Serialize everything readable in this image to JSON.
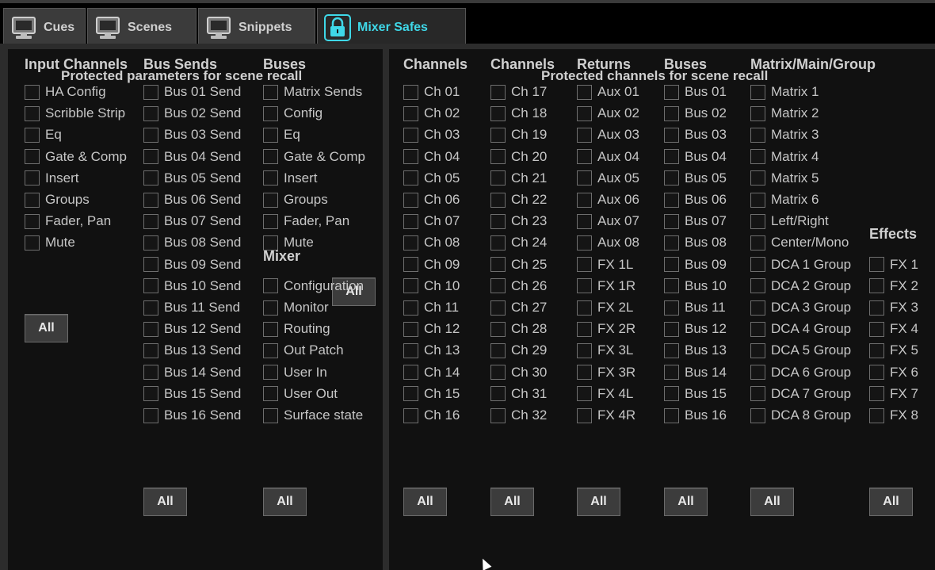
{
  "tabs": [
    {
      "label": "Cues",
      "icon": "monitor-icon",
      "active": false
    },
    {
      "label": "Scenes",
      "icon": "monitor-icon",
      "active": false
    },
    {
      "label": "Snippets",
      "icon": "monitor-icon",
      "active": false
    },
    {
      "label": "Mixer Safes",
      "icon": "lock-icon",
      "active": true
    }
  ],
  "accent_color": "#3fd8e8",
  "left_panel": {
    "title": "Protected parameters for scene recall",
    "columns": [
      {
        "header": "Input Channels",
        "items": [
          "HA Config",
          "Scribble Strip",
          "Eq",
          "Gate & Comp",
          "Insert",
          "Groups",
          "Fader, Pan",
          "Mute"
        ]
      },
      {
        "header": "Bus Sends",
        "items": [
          "Bus 01 Send",
          "Bus 02 Send",
          "Bus 03 Send",
          "Bus 04 Send",
          "Bus 05 Send",
          "Bus 06 Send",
          "Bus 07 Send",
          "Bus 08 Send",
          "Bus 09 Send",
          "Bus 10 Send",
          "Bus 11 Send",
          "Bus 12 Send",
          "Bus 13 Send",
          "Bus 14 Send",
          "Bus 15 Send",
          "Bus 16 Send"
        ]
      },
      {
        "header": "Buses",
        "items": [
          "Matrix Sends",
          "Config",
          "Eq",
          "Gate & Comp",
          "Insert",
          "Groups",
          "Fader, Pan",
          "Mute"
        ]
      },
      {
        "header": "Mixer",
        "items": [
          "Configuration",
          "Monitor",
          "Routing",
          "Out Patch",
          "User In",
          "User Out",
          "Surface state"
        ]
      }
    ],
    "all_label": "All"
  },
  "right_panel": {
    "title": "Protected channels for scene recall",
    "columns": [
      {
        "header": "Channels",
        "items": [
          "Ch 01",
          "Ch 02",
          "Ch 03",
          "Ch 04",
          "Ch 05",
          "Ch 06",
          "Ch 07",
          "Ch 08",
          "Ch 09",
          "Ch 10",
          "Ch 11",
          "Ch 12",
          "Ch 13",
          "Ch 14",
          "Ch 15",
          "Ch 16"
        ]
      },
      {
        "header": "Channels",
        "items": [
          "Ch 17",
          "Ch 18",
          "Ch 19",
          "Ch 20",
          "Ch 21",
          "Ch 22",
          "Ch 23",
          "Ch 24",
          "Ch 25",
          "Ch 26",
          "Ch 27",
          "Ch 28",
          "Ch 29",
          "Ch 30",
          "Ch 31",
          "Ch 32"
        ]
      },
      {
        "header": "Returns",
        "items": [
          "Aux 01",
          "Aux 02",
          "Aux 03",
          "Aux 04",
          "Aux 05",
          "Aux 06",
          "Aux 07",
          "Aux 08",
          "FX 1L",
          "FX 1R",
          "FX 2L",
          "FX 2R",
          "FX 3L",
          "FX 3R",
          "FX 4L",
          "FX 4R"
        ]
      },
      {
        "header": "Buses",
        "items": [
          "Bus 01",
          "Bus 02",
          "Bus 03",
          "Bus 04",
          "Bus 05",
          "Bus 06",
          "Bus 07",
          "Bus 08",
          "Bus 09",
          "Bus 10",
          "Bus 11",
          "Bus 12",
          "Bus 13",
          "Bus 14",
          "Bus 15",
          "Bus 16"
        ]
      },
      {
        "header": "Matrix/Main/Group",
        "items": [
          "Matrix 1",
          "Matrix 2",
          "Matrix 3",
          "Matrix 4",
          "Matrix 5",
          "Matrix 6",
          "Left/Right",
          "Center/Mono",
          "DCA 1 Group",
          "DCA 2 Group",
          "DCA 3 Group",
          "DCA 4 Group",
          "DCA 5 Group",
          "DCA 6 Group",
          "DCA 7 Group",
          "DCA 8 Group"
        ]
      },
      {
        "header": "Effects",
        "items": [
          "FX 1",
          "FX 2",
          "FX 3",
          "FX 4",
          "FX 5",
          "FX 6",
          "FX 7",
          "FX 8"
        ]
      }
    ],
    "all_label": "All"
  }
}
